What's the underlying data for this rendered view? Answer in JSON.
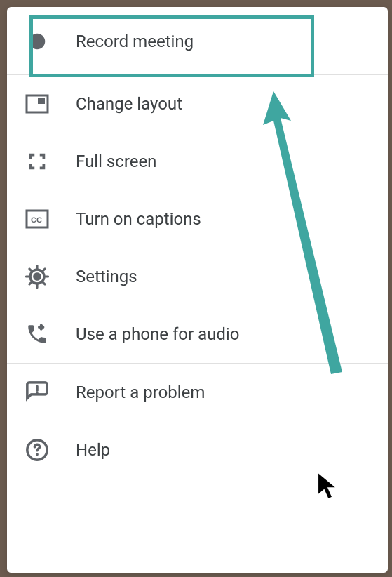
{
  "menu": {
    "section1": {
      "record": {
        "label": "Record meeting"
      }
    },
    "section2": {
      "layout": {
        "label": "Change layout"
      },
      "fullscreen": {
        "label": "Full screen"
      },
      "captions": {
        "label": "Turn on captions"
      },
      "settings": {
        "label": "Settings"
      },
      "phone": {
        "label": "Use a phone for audio"
      }
    },
    "section3": {
      "report": {
        "label": "Report a problem"
      },
      "help": {
        "label": "Help"
      }
    }
  },
  "colors": {
    "highlight": "#3fa6a0",
    "icon": "#5f6368",
    "text": "#3c4043"
  }
}
